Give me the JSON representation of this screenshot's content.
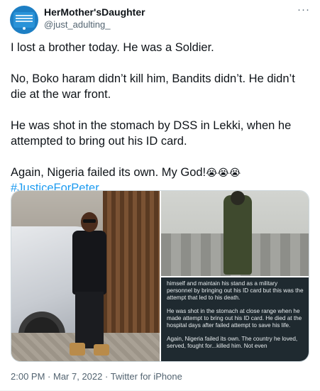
{
  "user": {
    "display_name": "HerMother'sDaughter",
    "handle": "@just_adulting_",
    "avatar_icon": "avatar"
  },
  "menu": {
    "more_label": "···"
  },
  "tweet": {
    "line1": "I lost a brother today. He was a Soldier.",
    "line2": "No, Boko haram didn’t kill him, Bandits didn’t. He didn’t die at the war front.",
    "line3": "He was shot in the stomach by DSS in Lekki, when he attempted to bring out his ID card.",
    "line4_text": "Again, Nigeria failed its own. My God!",
    "line4_emoji": "😭😭😭",
    "hashtag": "#JusticeForPeter"
  },
  "media": {
    "caption_p1": "himself and maintain his stand as a military personnel by bringing out his ID card but this was the attempt that led to his death.",
    "caption_p2": "He was shot in the stomach at close range when he made attempt to bring out his ID card. He died at the hospital days after failed attempt to save his life.",
    "caption_p3": "Again, Nigeria failed its own. The country he loved, served, fought for...killed him. Not even"
  },
  "meta": {
    "time": "2:00 PM",
    "sep1": " · ",
    "date": "Mar 7, 2022",
    "sep2": " · ",
    "source": "Twitter for iPhone"
  },
  "colors": {
    "link": "#1d9bf0",
    "secondary_text": "#536471",
    "primary_text": "#0f1419"
  }
}
